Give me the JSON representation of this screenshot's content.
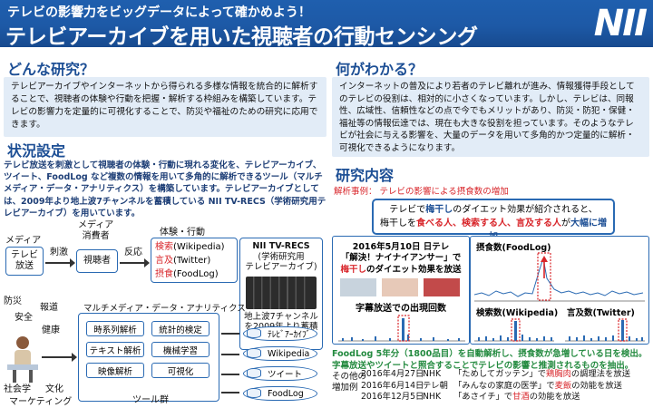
{
  "header": {
    "subtitle": "テレビの影響力をビッグデータによって確かめよう！",
    "title": "テレビアーカイブを用いた視聴者の行動センシング",
    "logo": "NII"
  },
  "what_research": {
    "heading": "どんな研究？",
    "body": "テレビアーカイブやインターネットから得られる多様な情報を統合的に解析することで、視聴者の体験や行動を把握・解析する枠組みを構築しています。テレビの影響力を定量的に可視化することで、防災や福祉のための研究に応用できます。"
  },
  "situation": {
    "heading": "状況設定",
    "body": "テレビ放送を刺激として視聴者の体験・行動に現れる変化を、テレビアーカイブ、ツイート、FoodLog など複数の情報を用いて多角的に解析できるツール（マルチメディア・データ・アナリティクス）を構築しています。テレビアーカイブとしては、2009年より地上波7チャンネルを蓄積している NII TV-RECS（学術研究用テレビアーカイブ）を用いています。"
  },
  "diagram": {
    "media_label": "メディア",
    "tv_box": "テレビ\n放送",
    "stimulus_label": "刺激",
    "consumer_label": "メディア\n消費者",
    "viewer_box": "視聴者",
    "reaction_label": "反応",
    "behavior_label": "体験・行動",
    "behaviors": [
      {
        "red": "検索",
        "rest": "(Wikipedia)"
      },
      {
        "red": "言及",
        "rest": "(Twitter)"
      },
      {
        "red": "摂食",
        "rest": "(FoodLog)"
      }
    ],
    "nii_title": "NII TV-RECS",
    "nii_sub1": "(学術研究用",
    "nii_sub2": "テレビアーカイブ)",
    "nii_note1": "地上波7チャンネル",
    "nii_note2": "を2009年より蓄積",
    "domains": [
      "防災",
      "報道",
      "安全",
      "健康",
      "社会学",
      "文化",
      "マーケティング"
    ],
    "mma_title": "マルチメディア・データ・アナリティクス",
    "tools": [
      "時系列解析",
      "統計的検定",
      "テキスト解析",
      "機械学習",
      "映像解析",
      "可視化"
    ],
    "tools_label": "ツール群",
    "sources": [
      "ﾃﾚﾋﾞｱｰｶｲﾌﾞ",
      "Wikipedia",
      "ツイート",
      "FoodLog"
    ]
  },
  "what_learn": {
    "heading": "何がわかる？",
    "body": "インターネットの普及により若者のテレビ離れが進み、情報獲得手段としてのテレビの役割は、相対的に小さくなっています。しかし、テレビは、同報性、広域性、信頼性などの点で今でもメリットがあり、防災・防犯・保健・福祉等の情報伝達では、現在も大きな役割を担っています。そのようなテレビが社会に与える影響を、大量のデータを用いて多角的かつ定量的に解析・可視化できるようになります。"
  },
  "research": {
    "heading": "研究内容",
    "example_label": "解析事例： テレビの影響による摂食数の増加",
    "effect": {
      "l1a": "テレビで",
      "l1b": "梅干し",
      "l1c": "のダイエット効果が紹介されると、",
      "l2a": "梅干しを",
      "l2b": "食べる人、検索する人、言及する人",
      "l2c": "が",
      "l2d": "大幅に増加"
    },
    "example_panel": {
      "line1": "2016年5月10日 日テレ",
      "line2": "「解決！ナイナイアンサー」で",
      "line3a": "梅干し",
      "line3b": "のダイエット効果を放送",
      "caption": "字幕放送での出現回数"
    },
    "chart_labels": {
      "foodlog": "摂食数(FoodLog)",
      "wiki": "検索数(Wikipedia)",
      "twitter": "言及数(Twitter)"
    },
    "foodlog_note": "FoodLog 5年分（1800品目）を自動解析し、摂食数が急増している日を検出。字幕放送やツイートと照合することでテレビの影響と推測されるものを抽出。",
    "other_label1": "その他の",
    "other_label2": "増加例",
    "other_examples": [
      {
        "date": "2016年4月27日",
        "ch": "NHK",
        "pre": "「ためしてガッテン」で",
        "food": "鶏胸肉",
        "post": "の調理法を放送"
      },
      {
        "date": "2016年6月14日",
        "ch": "テレ朝",
        "pre": "「みんなの家庭の医学」で",
        "food": "麦飯",
        "post": "の効能を放送"
      },
      {
        "date": "2016年12月5日",
        "ch": "NHK",
        "pre": "「あさイチ」で",
        "food": "甘酒",
        "post": "の効能を放送"
      }
    ]
  },
  "colors": {
    "header_bg": "#1d59a6",
    "heading": "#1d4f95",
    "panel_bg": "#e2ecf7",
    "accent_red": "#d8252a",
    "note_green": "#238a3f"
  }
}
